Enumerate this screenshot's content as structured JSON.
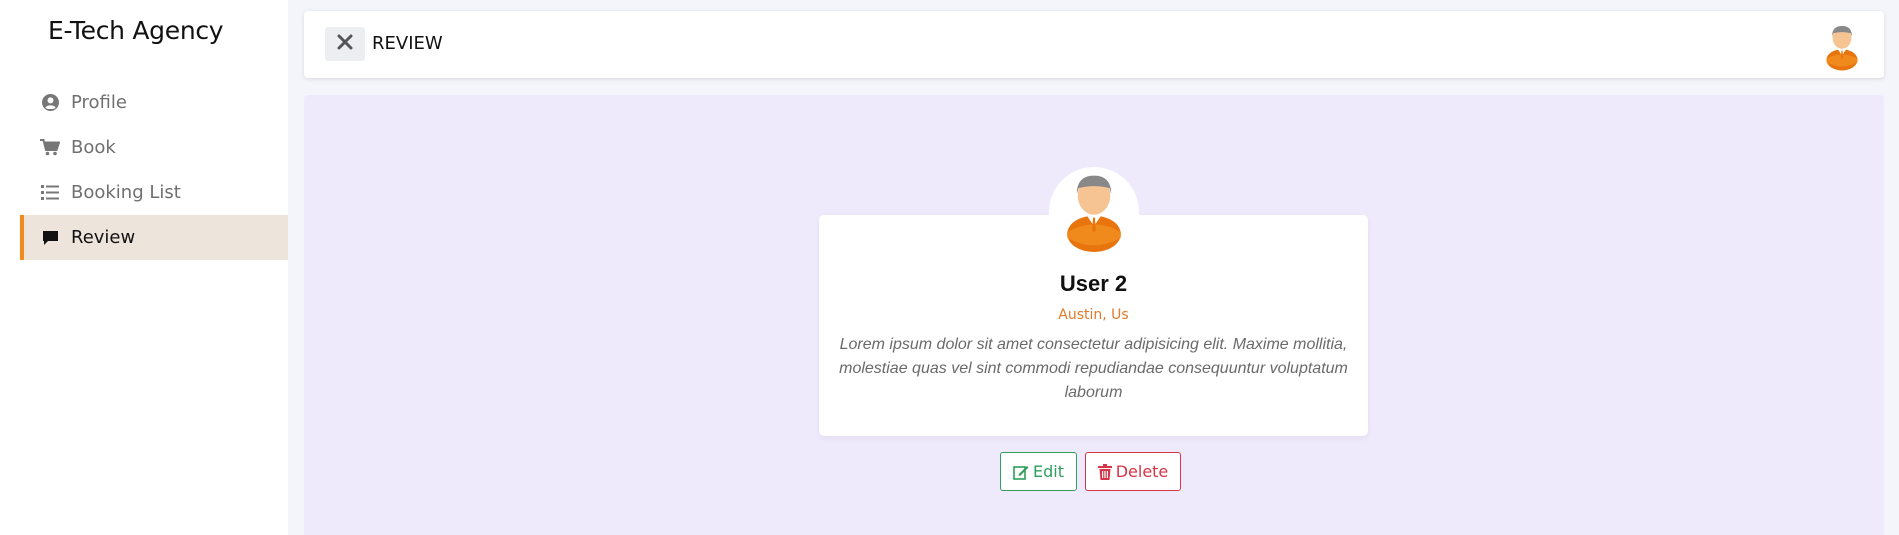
{
  "brand": "E-Tech Agency",
  "sidebar": {
    "items": [
      {
        "label": "Profile",
        "icon": "user-circle-icon"
      },
      {
        "label": "Book",
        "icon": "cart-icon"
      },
      {
        "label": "Booking List",
        "icon": "list-icon"
      },
      {
        "label": "Review",
        "icon": "comment-icon",
        "active": true
      }
    ]
  },
  "header": {
    "title": "REVIEW",
    "close_icon": "close-icon",
    "avatar_icon": "user-avatar-icon"
  },
  "review": {
    "name": "User 2",
    "location": "Austin, Us",
    "text": "Lorem ipsum dolor sit amet consectetur adipisicing elit. Maxime mollitia, molestiae quas vel sint commodi repudiandae consequuntur voluptatum laborum"
  },
  "actions": {
    "edit_label": "Edit",
    "delete_label": "Delete"
  },
  "colors": {
    "accent": "#f28a1e",
    "active_bg": "#ede4dc",
    "main_bg": "#eeeafc",
    "location": "#e07a2a",
    "edit": "#2e9e5b",
    "delete": "#d63447"
  }
}
